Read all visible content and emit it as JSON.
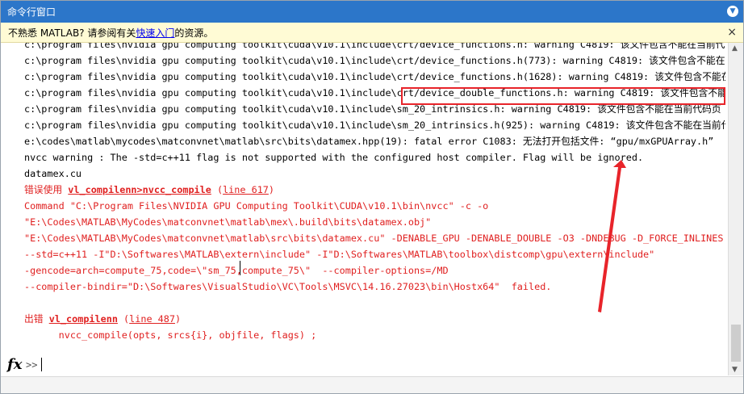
{
  "window": {
    "title": "命令行窗口",
    "title_button_icon": "▼"
  },
  "infobar": {
    "text_before": "不熟悉 MATLAB? 请参阅有关",
    "link": "快速入门",
    "text_after": "的资源。",
    "close": "×"
  },
  "console": {
    "lines": [
      "c:\\program files\\nvidia gpu computing toolkit\\cuda\\v10.1\\include\\crt/device_functions.h: warning C4819: 该文件包含不能在当前代",
      "c:\\program files\\nvidia gpu computing toolkit\\cuda\\v10.1\\include\\crt/device_functions.h(773): warning C4819: 该文件包含不能在当",
      "c:\\program files\\nvidia gpu computing toolkit\\cuda\\v10.1\\include\\crt/device_functions.h(1628): warning C4819: 该文件包含不能在",
      "c:\\program files\\nvidia gpu computing toolkit\\cuda\\v10.1\\include\\crt/device_double_functions.h: warning C4819: 该文件包含不能在",
      "c:\\program files\\nvidia gpu computing toolkit\\cuda\\v10.1\\include\\sm_20_intrinsics.h: warning C4819: 该文件包含不能在当前代码页",
      "c:\\program files\\nvidia gpu computing toolkit\\cuda\\v10.1\\include\\sm_20_intrinsics.h(925): warning C4819: 该文件包含不能在当前代"
    ],
    "datamex_line": "e:\\codes\\matlab\\mycodes\\matconvnet\\matlab\\src\\bits\\datamex.hpp(19):",
    "fatal_error": "fatal error C1083: 无法打开包括文件: “gpu/mxGPUArray.h”",
    "nvcc_warning": "nvcc warning : The -std=c++11 flag is not supported with the configured host compiler. Flag will be ignored.",
    "datamex_cu": "datamex.cu",
    "error_prefix": "错误使用 ",
    "error_func": "vl_compilenn>nvcc_compile",
    "error_line": "line 617",
    "cmd_lines": [
      "Command \"C:\\Program Files\\NVIDIA GPU Computing Toolkit\\CUDA\\v10.1\\bin\\nvcc\" -c -o",
      "\"E:\\Codes\\MATLAB\\MyCodes\\matconvnet\\matlab\\mex\\.build\\bits\\datamex.obj\"",
      "\"E:\\Codes\\MATLAB\\MyCodes\\matconvnet\\matlab\\src\\bits\\datamex.cu\" -DENABLE_GPU -DENABLE_DOUBLE -O3 -DNDEBUG -D_FORCE_INLINES",
      "--std=c++11 -I\"D:\\Softwares\\MATLAB\\extern\\include\" -I\"D:\\Softwares\\MATLAB\\toolbox\\distcomp\\gpu\\extern\\include\"",
      "-gencode=arch=compute_75,code=\\\"sm_75,compute_75\\\"  --compiler-options=/MD",
      "--compiler-bindir=\"D:\\Softwares\\VisualStudio\\VC\\Tools\\MSVC\\14.16.27023\\bin\\Hostx64\"  failed."
    ],
    "out_prefix": "出错 ",
    "out_func": "vl_compilenn",
    "out_line": "line 487",
    "call_line": "      nvcc_compile(opts, srcs{i}, objfile, flags) ;"
  },
  "prompt": {
    "fx": "fx",
    "symbol": ">>"
  },
  "colors": {
    "titlebar": "#2c76c9",
    "error": "#e02020",
    "annotation": "#e8242a",
    "infobar": "#fffbd5"
  }
}
